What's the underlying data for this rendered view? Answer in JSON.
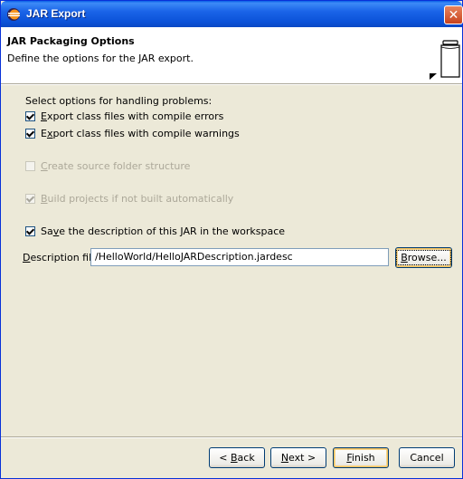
{
  "window": {
    "title": "JAR Export",
    "close_glyph": "✕"
  },
  "banner": {
    "title": "JAR Packaging Options",
    "description": "Define the options for the JAR export."
  },
  "options": {
    "section_label": "Select options for handling problems:",
    "export_errors": {
      "pre": "",
      "mnemonic": "E",
      "post": "xport class files with compile errors",
      "checked": true,
      "enabled": true
    },
    "export_warnings": {
      "pre": "E",
      "mnemonic": "x",
      "post": "port class files with compile warnings",
      "checked": true,
      "enabled": true
    },
    "source_folder": {
      "pre": "",
      "mnemonic": "C",
      "post": "reate source folder structure",
      "checked": false,
      "enabled": false
    },
    "build_projects": {
      "pre": "",
      "mnemonic": "B",
      "post": "uild projects if not built automatically",
      "checked": true,
      "enabled": false
    },
    "save_description": {
      "pre": "Sa",
      "mnemonic": "v",
      "post": "e the description of this JAR in the workspace",
      "checked": true,
      "enabled": true
    }
  },
  "description_file": {
    "label_pre": "",
    "label_mnemonic": "D",
    "label_post": "escription file:",
    "value": "/HelloWorld/HelloJARDescription.jardesc",
    "browse_pre": "",
    "browse_mnemonic": "B",
    "browse_post": "rowse..."
  },
  "buttons": {
    "back_pre": "< ",
    "back_mnemonic": "B",
    "back_post": "ack",
    "next_mnemonic": "N",
    "next_post": "ext >",
    "finish_mnemonic": "F",
    "finish_post": "inish",
    "cancel": "Cancel"
  },
  "icons": {
    "title_icon": "eclipse-icon",
    "banner_icon": "jar-icon"
  }
}
